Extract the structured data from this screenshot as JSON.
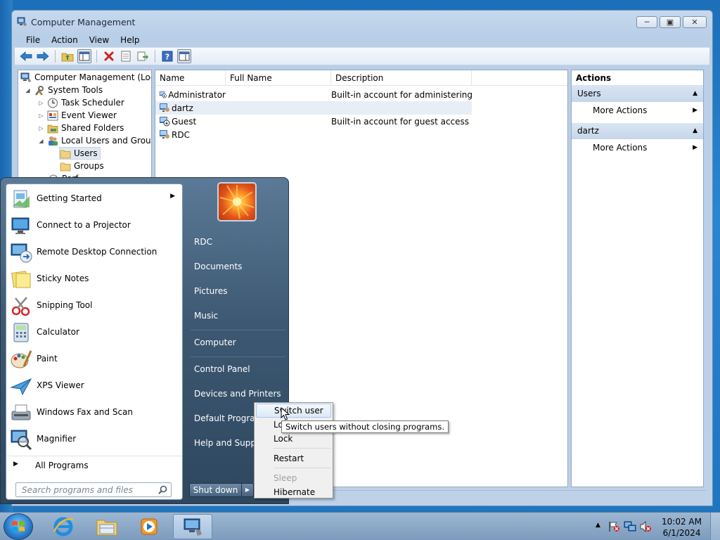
{
  "window": {
    "title": "Computer Management",
    "menus": [
      "File",
      "Action",
      "View",
      "Help"
    ]
  },
  "tree": [
    {
      "label": "Computer Management (Local",
      "icon": "computer-management-icon"
    },
    {
      "label": "System Tools",
      "icon": "tools-icon"
    },
    {
      "label": "Task Scheduler",
      "icon": "clock-icon"
    },
    {
      "label": "Event Viewer",
      "icon": "event-viewer-icon"
    },
    {
      "label": "Shared Folders",
      "icon": "shared-folder-icon"
    },
    {
      "label": "Local Users and Groups",
      "icon": "users-icon"
    },
    {
      "label": "Users",
      "icon": "folder-icon"
    },
    {
      "label": "Groups",
      "icon": "folder-icon"
    },
    {
      "label": "Perf",
      "icon": "performance-icon"
    }
  ],
  "list": {
    "columns": [
      "Name",
      "Full Name",
      "Description"
    ],
    "rows": [
      {
        "name": "Administrator",
        "full_name": "",
        "description": "Built-in account for administering..."
      },
      {
        "name": "dartz",
        "full_name": "",
        "description": ""
      },
      {
        "name": "Guest",
        "full_name": "",
        "description": "Built-in account for guest access t..."
      },
      {
        "name": "RDC",
        "full_name": "",
        "description": ""
      }
    ]
  },
  "actions": {
    "header": "Actions",
    "sections": [
      {
        "title": "Users",
        "item": "More Actions"
      },
      {
        "title": "dartz",
        "item": "More Actions"
      }
    ]
  },
  "start_menu": {
    "programs": [
      {
        "label": "Getting Started",
        "icon": "getting-started-icon",
        "has_submenu": true
      },
      {
        "label": "Connect to a Projector",
        "icon": "projector-icon",
        "has_submenu": false
      },
      {
        "label": "Remote Desktop Connection",
        "icon": "remote-desktop-icon",
        "has_submenu": false
      },
      {
        "label": "Sticky Notes",
        "icon": "sticky-notes-icon",
        "has_submenu": false
      },
      {
        "label": "Snipping Tool",
        "icon": "snipping-tool-icon",
        "has_submenu": false
      },
      {
        "label": "Calculator",
        "icon": "calculator-icon",
        "has_submenu": false
      },
      {
        "label": "Paint",
        "icon": "paint-icon",
        "has_submenu": false
      },
      {
        "label": "XPS Viewer",
        "icon": "xps-viewer-icon",
        "has_submenu": false
      },
      {
        "label": "Windows Fax and Scan",
        "icon": "fax-scan-icon",
        "has_submenu": false
      },
      {
        "label": "Magnifier",
        "icon": "magnifier-icon",
        "has_submenu": false
      }
    ],
    "all_programs": "All Programs",
    "search_placeholder": "Search programs and files",
    "right_items": [
      "RDC",
      "Documents",
      "Pictures",
      "Music",
      "Computer",
      "Control Panel",
      "Devices and Printers",
      "Default Programs",
      "Help and Support"
    ],
    "shutdown_label": "Shut down"
  },
  "shutdown_menu": {
    "items": [
      {
        "label": "Switch user",
        "state": "highlighted"
      },
      {
        "label": "Log off",
        "state": "normal"
      },
      {
        "label": "Lock",
        "state": "normal"
      },
      {
        "label": "Restart",
        "state": "normal"
      },
      {
        "label": "Sleep",
        "state": "disabled"
      },
      {
        "label": "Hibernate",
        "state": "normal"
      }
    ],
    "tooltip": "Switch users without closing programs."
  },
  "taskbar": {
    "clock_time": "10:02 AM",
    "clock_date": "6/1/2024"
  }
}
